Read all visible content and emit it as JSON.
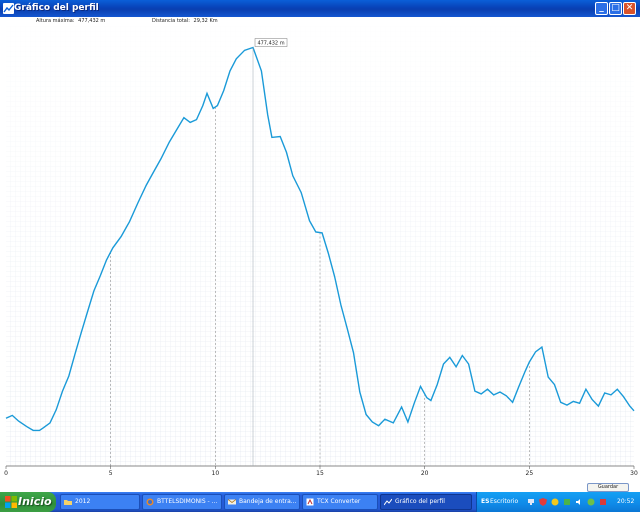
{
  "window": {
    "title": "Gráfico del perfil",
    "min_label": "_",
    "max_label": "□",
    "close_label": "✕"
  },
  "info": {
    "max_alt_label": "Altura máxima:",
    "max_alt_value": "477,432 m",
    "distance_label": "Distancia total:",
    "distance_value": "29,32 Km"
  },
  "marker_label": "477,432 m",
  "save_button": "Guardar como...",
  "taskbar": {
    "start_label": "Inicio",
    "tasks": [
      {
        "label": "2012",
        "icon": "folder-icon"
      },
      {
        "label": "BTTELSDIMONIS - ...",
        "icon": "browser-icon"
      },
      {
        "label": "Bandeja de entra...",
        "icon": "mail-icon"
      },
      {
        "label": "TCX Converter",
        "icon": "app-icon"
      },
      {
        "label": "Gráfico del perfil",
        "icon": "chart-icon"
      }
    ],
    "tray": {
      "lang": "ES",
      "desktop_label": "Escritorio",
      "clock": "20:52"
    }
  },
  "colors": {
    "line": "#1a9ad8",
    "grid": "#cfd8e4",
    "title_bar": "#0842b8",
    "task_active": "#1b4dbd"
  },
  "chart_data": {
    "type": "line",
    "x_ticks": [
      "0",
      "5",
      "10",
      "15",
      "20",
      "25",
      "30"
    ],
    "xlim": [
      0,
      30
    ],
    "ylim": [
      30,
      500
    ],
    "grid": true,
    "series": [
      {
        "x": [
          0,
          0.3,
          0.6,
          1,
          1.3,
          1.6,
          1.8,
          2.1,
          2.4,
          2.7,
          3,
          3.3,
          3.6,
          3.9,
          4.2,
          4.5,
          4.8,
          5.1,
          5.5,
          5.9,
          6.3,
          6.7,
          7,
          7.4,
          7.8,
          8.2,
          8.5,
          8.8,
          9.1,
          9.4,
          9.6,
          9.9,
          10.1,
          10.4,
          10.7,
          11,
          11.4,
          11.8,
          12.2,
          12.5,
          12.7,
          13.1,
          13.4,
          13.7,
          14.1,
          14.5,
          14.8,
          15.1,
          15.4,
          15.7,
          16,
          16.3,
          16.6,
          16.9,
          17.2,
          17.5,
          17.8,
          18.1,
          18.5,
          18.9,
          19.2,
          19.5,
          19.8,
          20.1,
          20.3,
          20.6,
          20.9,
          21.2,
          21.5,
          21.8,
          22.1,
          22.4,
          22.7,
          23,
          23.3,
          23.6,
          23.9,
          24.2,
          24.5,
          24.8,
          25,
          25.3,
          25.6,
          25.9,
          26.2,
          26.5,
          26.8,
          27.1,
          27.4,
          27.7,
          28,
          28.3,
          28.6,
          28.9,
          29.2,
          29.5,
          29.8,
          30
        ],
        "y": [
          81,
          84,
          78,
          72,
          68,
          68,
          71,
          76,
          90,
          110,
          126,
          150,
          173,
          195,
          217,
          233,
          250,
          263,
          275,
          291,
          311,
          330,
          342,
          358,
          376,
          391,
          402,
          397,
          400,
          415,
          428,
          412,
          415,
          431,
          452,
          465,
          474,
          477,
          452,
          405,
          381,
          382,
          365,
          340,
          322,
          292,
          280,
          279,
          257,
          232,
          202,
          177,
          151,
          109,
          85,
          77,
          73,
          80,
          76,
          93,
          77,
          97,
          115,
          103,
          100,
          117,
          139,
          146,
          136,
          148,
          139,
          110,
          107,
          112,
          106,
          109,
          105,
          98,
          115,
          131,
          141,
          152,
          157,
          125,
          117,
          98,
          95,
          99,
          97,
          112,
          101,
          94,
          108,
          106,
          112,
          104,
          94,
          89
        ]
      }
    ]
  }
}
